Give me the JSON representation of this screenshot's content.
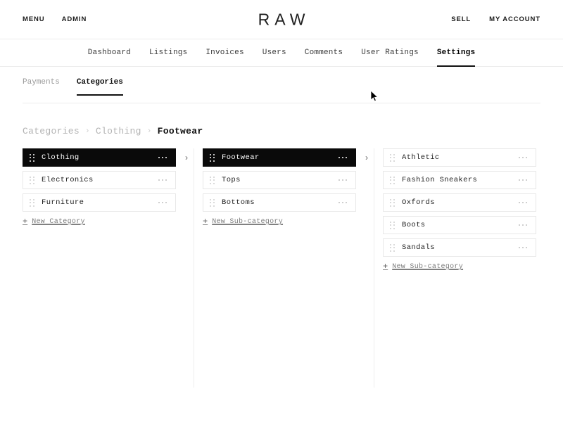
{
  "header": {
    "brand": "RAW",
    "left_links": [
      {
        "label": "MENU",
        "name": "menu-link"
      },
      {
        "label": "ADMIN",
        "name": "admin-link"
      }
    ],
    "right_links": [
      {
        "label": "SELL",
        "name": "sell-link"
      },
      {
        "label": "MY ACCOUNT",
        "name": "my-account-link"
      }
    ]
  },
  "main_nav": {
    "items": [
      {
        "label": "Dashboard",
        "active": false
      },
      {
        "label": "Listings",
        "active": false
      },
      {
        "label": "Invoices",
        "active": false
      },
      {
        "label": "Users",
        "active": false
      },
      {
        "label": "Comments",
        "active": false
      },
      {
        "label": "User Ratings",
        "active": false
      },
      {
        "label": "Settings",
        "active": true
      }
    ]
  },
  "sub_tabs": {
    "items": [
      {
        "label": "Payments",
        "active": false
      },
      {
        "label": "Categories",
        "active": true
      }
    ]
  },
  "breadcrumb": {
    "separator": "›",
    "items": [
      {
        "label": "Categories",
        "current": false
      },
      {
        "label": "Clothing",
        "current": false
      },
      {
        "label": "Footwear",
        "current": true
      }
    ]
  },
  "columns": [
    {
      "name": "categories-column",
      "items": [
        {
          "label": "Clothing",
          "selected": true,
          "has_chevron": true
        },
        {
          "label": "Electronics",
          "selected": false,
          "has_chevron": false
        },
        {
          "label": "Furniture",
          "selected": false,
          "has_chevron": false
        }
      ],
      "add_link": {
        "plus": "+",
        "label": "New Category"
      }
    },
    {
      "name": "subcategories-column",
      "items": [
        {
          "label": "Footwear",
          "selected": true,
          "has_chevron": true
        },
        {
          "label": "Tops",
          "selected": false,
          "has_chevron": false
        },
        {
          "label": "Bottoms",
          "selected": false,
          "has_chevron": false
        }
      ],
      "add_link": {
        "plus": "+",
        "label": "New Sub-category"
      }
    },
    {
      "name": "footwear-subcategories-column",
      "items": [
        {
          "label": "Athletic",
          "selected": false,
          "has_chevron": false
        },
        {
          "label": "Fashion Sneakers",
          "selected": false,
          "has_chevron": false
        },
        {
          "label": "Oxfords",
          "selected": false,
          "has_chevron": false
        },
        {
          "label": "Boots",
          "selected": false,
          "has_chevron": false
        },
        {
          "label": "Sandals",
          "selected": false,
          "has_chevron": false
        }
      ],
      "add_link": {
        "plus": "+",
        "label": "New Sub-category"
      }
    }
  ],
  "icons": {
    "drag_handle": "drag-handle-icon",
    "overflow_menu": "overflow-menu-icon",
    "chevron_right": "chevron-right-icon",
    "cursor": "mouse-cursor"
  },
  "colors": {
    "selected_bg": "#0a0a0a",
    "border": "#e8e8e8",
    "muted_text": "#9a9a9a",
    "accent_text": "#111111"
  }
}
